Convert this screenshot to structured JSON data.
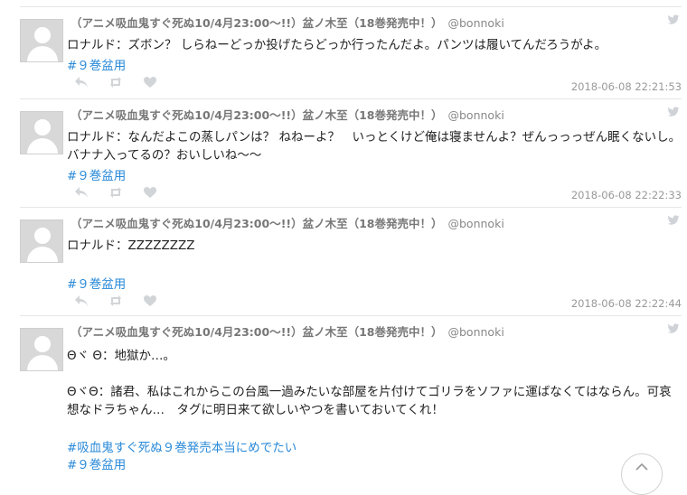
{
  "tweets": [
    {
      "name": "（アニメ吸血鬼すぐ死ぬ10/4月23:00～!!）盆ノ木至（18巻発売中！）",
      "handle": "@bonnoki",
      "text": "ロナルド：ズボン？ しらねーどっか投げたらどっか行ったんだよ。パンツは履いてんだろうがよ。",
      "hashtags": [
        "#９巻盆用"
      ],
      "timestamp": "2018-06-08 22:21:53"
    },
    {
      "name": "（アニメ吸血鬼すぐ死ぬ10/4月23:00～!!）盆ノ木至（18巻発売中！）",
      "handle": "@bonnoki",
      "text": "ロナルド：なんだよこの蒸しパンは？ ねねーよ？　いっとくけど俺は寝ませんよ？ぜんっっっぜん眠くないし。バナナ入ってるの？おいしいね〜〜",
      "hashtags": [
        "#９巻盆用"
      ],
      "timestamp": "2018-06-08 22:22:33"
    },
    {
      "name": "（アニメ吸血鬼すぐ死ぬ10/4月23:00～!!）盆ノ木至（18巻発売中！）",
      "handle": "@bonnoki",
      "text": "ロナルド：ZZZZZZZZ",
      "hashtags": [
        "#９巻盆用"
      ],
      "timestamp": "2018-06-08 22:22:44"
    },
    {
      "name": "（アニメ吸血鬼すぐ死ぬ10/4月23:00～!!）盆ノ木至（18巻発売中！）",
      "handle": "@bonnoki",
      "text": "Θヾ Θ：地獄か…。\n\nΘヾΘ：諸君、私はこれからこの台風一過みたいな部屋を片付けてゴリラをソファに運ばなくてはならん。可哀想なドラちゃん…　タグに明日来て欲しいやつを書いておいてくれ！",
      "hashtags": [
        "#吸血鬼すぐ死ぬ９巻発売本当にめでたい",
        "#９巻盆用"
      ]
    }
  ],
  "icons": {
    "avatar": "default-user-avatar",
    "service": "twitter-bird-icon",
    "actions": [
      "reply-icon",
      "retweet-icon",
      "like-icon"
    ],
    "scroll": "scroll-to-top-icon"
  },
  "colors": {
    "hashtag": "#2a8ad8",
    "name": "#777777",
    "timestamp": "#999999",
    "divider": "#e6e6e6"
  }
}
